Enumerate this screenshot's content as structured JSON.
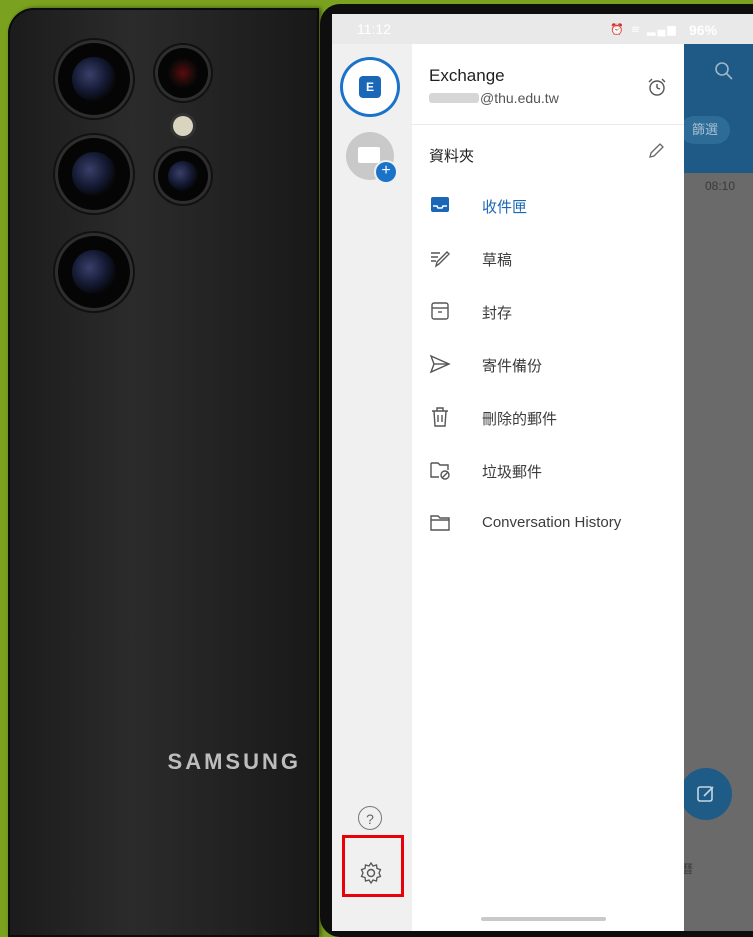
{
  "statusbar": {
    "time": "11:12",
    "battery": "96%"
  },
  "account": {
    "name": "Exchange",
    "email_domain": "@thu.edu.tw",
    "badge": "E"
  },
  "folders": {
    "title": "資料夾",
    "items": [
      {
        "label": "收件匣",
        "icon": "inbox-icon"
      },
      {
        "label": "草稿",
        "icon": "drafts-icon"
      },
      {
        "label": "封存",
        "icon": "archive-icon"
      },
      {
        "label": "寄件備份",
        "icon": "sent-icon"
      },
      {
        "label": "刪除的郵件",
        "icon": "trash-icon"
      },
      {
        "label": "垃圾郵件",
        "icon": "junk-icon"
      },
      {
        "label": "Conversation History",
        "icon": "folder-icon"
      }
    ]
  },
  "background_app": {
    "filter_label": "篩選",
    "list_time": "08:10",
    "calendar_label": "曆"
  },
  "phone": {
    "brand": "SAMSUNG"
  },
  "colors": {
    "accent": "#1a67b8",
    "highlight": "#e8000b",
    "background": "#7aa21f"
  }
}
